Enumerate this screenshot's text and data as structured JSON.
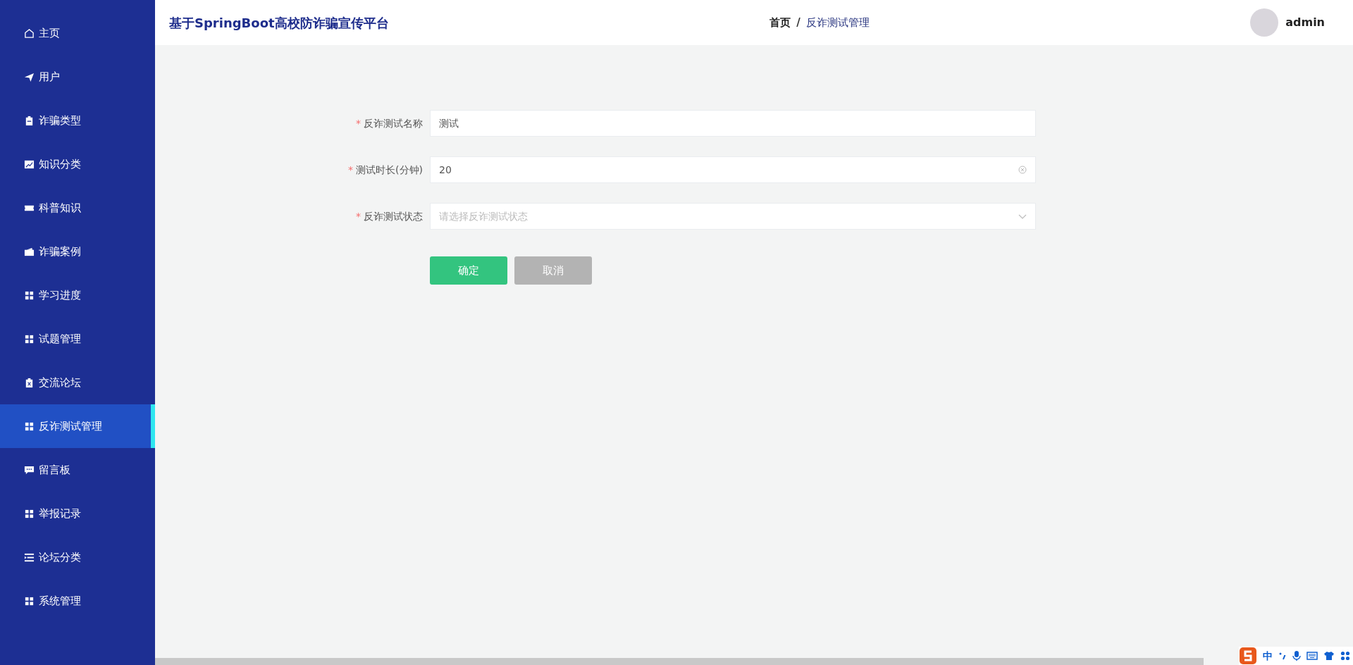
{
  "sidebar": {
    "items": [
      {
        "label": "主页",
        "selected": false
      },
      {
        "label": "用户",
        "selected": false
      },
      {
        "label": "诈骗类型",
        "selected": false
      },
      {
        "label": "知识分类",
        "selected": false
      },
      {
        "label": "科普知识",
        "selected": false
      },
      {
        "label": "诈骗案例",
        "selected": false
      },
      {
        "label": "学习进度",
        "selected": false
      },
      {
        "label": "试题管理",
        "selected": false
      },
      {
        "label": "交流论坛",
        "selected": false
      },
      {
        "label": "反诈测试管理",
        "selected": true
      },
      {
        "label": "留言板",
        "selected": false
      },
      {
        "label": "举报记录",
        "selected": false
      },
      {
        "label": "论坛分类",
        "selected": false
      },
      {
        "label": "系统管理",
        "selected": false
      }
    ]
  },
  "header": {
    "title": "基于SpringBoot高校防诈骗宣传平台",
    "breadcrumb": [
      "首页",
      "反诈测试管理"
    ],
    "breadcrumb_separator": "/",
    "user": "admin"
  },
  "form": {
    "fields": [
      {
        "kind": "text",
        "label": "反诈测试名称",
        "required_mark": "*",
        "value": "测试"
      },
      {
        "kind": "clearable",
        "label": "测试时长(分钟)",
        "required_mark": "*",
        "value": "20"
      },
      {
        "kind": "select",
        "label": "反诈测试状态",
        "required_mark": "*",
        "placeholder": "请选择反诈测试状态"
      }
    ],
    "buttons": [
      {
        "kind": "primary",
        "label": "确定"
      },
      {
        "kind": "secondary",
        "label": "取消"
      }
    ]
  },
  "ime": {
    "mode": "中"
  }
}
